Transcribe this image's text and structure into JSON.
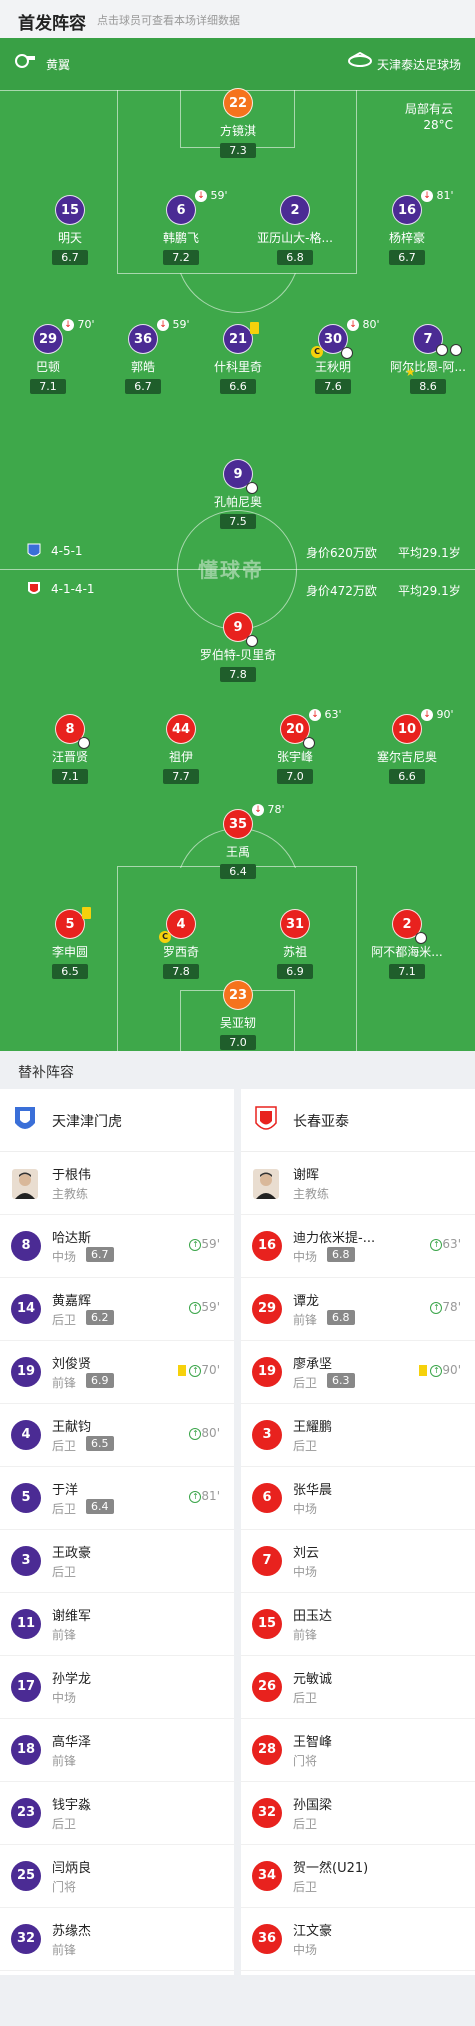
{
  "header": {
    "title": "首发阵容",
    "subtitle": "点击球员可查看本场详细数据"
  },
  "pitch": {
    "weather_icon_label": "whistle-icon",
    "whistle_name": "黄翼",
    "stadium": "天津泰达足球场",
    "weather": "局部有云",
    "temp": "28°C",
    "watermark": "懂球帝",
    "home": {
      "formation": "4-5-1",
      "value": "身价620万欧",
      "avg_age": "平均29.1岁"
    },
    "away": {
      "formation": "4-1-4-1",
      "value": "身价472万欧",
      "avg_age": "平均29.1岁"
    }
  },
  "home_players": [
    {
      "num": "22",
      "name": "方镜淇",
      "rating": "7.3",
      "color": "orange"
    },
    {
      "num": "15",
      "name": "明天",
      "rating": "6.7",
      "color": "purple"
    },
    {
      "num": "6",
      "name": "韩鹏飞",
      "rating": "7.2",
      "color": "purple",
      "sub": "59'"
    },
    {
      "num": "2",
      "name": "亚历山大-格...",
      "rating": "6.8",
      "color": "purple"
    },
    {
      "num": "16",
      "name": "杨梓豪",
      "rating": "6.7",
      "color": "purple",
      "sub": "81'"
    },
    {
      "num": "29",
      "name": "巴顿",
      "rating": "7.1",
      "color": "purple",
      "sub": "70'"
    },
    {
      "num": "36",
      "name": "郭皓",
      "rating": "6.7",
      "color": "purple",
      "sub": "59'"
    },
    {
      "num": "21",
      "name": "什科里奇",
      "rating": "6.6",
      "color": "purple"
    },
    {
      "num": "30",
      "name": "王秋明",
      "rating": "7.6",
      "color": "purple",
      "sub": "80'"
    },
    {
      "num": "7",
      "name": "阿尔比恩-阿...",
      "rating": "8.6",
      "color": "purple"
    },
    {
      "num": "9",
      "name": "孔帕尼奥",
      "rating": "7.5",
      "color": "purple"
    }
  ],
  "away_players": [
    {
      "num": "9",
      "name": "罗伯特-贝里奇",
      "rating": "7.8",
      "color": "red"
    },
    {
      "num": "8",
      "name": "汪晋贤",
      "rating": "7.1",
      "color": "red"
    },
    {
      "num": "44",
      "name": "祖伊",
      "rating": "7.7",
      "color": "red"
    },
    {
      "num": "20",
      "name": "张宇峰",
      "rating": "7.0",
      "color": "red",
      "sub": "63'"
    },
    {
      "num": "10",
      "name": "塞尔吉尼奥",
      "rating": "6.6",
      "color": "red",
      "sub": "90'"
    },
    {
      "num": "35",
      "name": "王禹",
      "rating": "6.4",
      "color": "red",
      "sub": "78'"
    },
    {
      "num": "5",
      "name": "李申圆",
      "rating": "6.5",
      "color": "red"
    },
    {
      "num": "4",
      "name": "罗西奇",
      "rating": "7.8",
      "color": "red"
    },
    {
      "num": "31",
      "name": "苏祖",
      "rating": "6.9",
      "color": "red"
    },
    {
      "num": "2",
      "name": "阿不都海米...",
      "rating": "7.1",
      "color": "red"
    },
    {
      "num": "23",
      "name": "吴亚轫",
      "rating": "7.0",
      "color": "orange"
    }
  ],
  "subs": {
    "title": "替补阵容",
    "home_team": "天津津门虎",
    "away_team": "长春亚泰",
    "home_coach": {
      "name": "于根伟",
      "role": "主教练"
    },
    "away_coach": {
      "name": "谢晖",
      "role": "主教练"
    },
    "home": [
      {
        "num": "8",
        "name": "哈达斯",
        "pos": "中场",
        "rating": "6.7",
        "ev": "59'"
      },
      {
        "num": "14",
        "name": "黄嘉辉",
        "pos": "后卫",
        "rating": "6.2",
        "ev": "59'"
      },
      {
        "num": "19",
        "name": "刘俊贤",
        "pos": "前锋",
        "rating": "6.9",
        "ev": "70'",
        "yc": true
      },
      {
        "num": "4",
        "name": "王献钧",
        "pos": "后卫",
        "rating": "6.5",
        "ev": "80'"
      },
      {
        "num": "5",
        "name": "于洋",
        "pos": "后卫",
        "rating": "6.4",
        "ev": "81'"
      },
      {
        "num": "3",
        "name": "王政豪",
        "pos": "后卫"
      },
      {
        "num": "11",
        "name": "谢维军",
        "pos": "前锋"
      },
      {
        "num": "17",
        "name": "孙学龙",
        "pos": "中场"
      },
      {
        "num": "18",
        "name": "高华泽",
        "pos": "前锋"
      },
      {
        "num": "23",
        "name": "钱宇淼",
        "pos": "后卫"
      },
      {
        "num": "25",
        "name": "闫炳良",
        "pos": "门将"
      },
      {
        "num": "32",
        "name": "苏缘杰",
        "pos": "前锋"
      }
    ],
    "away": [
      {
        "num": "16",
        "name": "迪力依米提-...",
        "pos": "中场",
        "rating": "6.8",
        "ev": "63'"
      },
      {
        "num": "29",
        "name": "谭龙",
        "pos": "前锋",
        "rating": "6.8",
        "ev": "78'"
      },
      {
        "num": "19",
        "name": "廖承坚",
        "pos": "后卫",
        "rating": "6.3",
        "ev": "90'",
        "yc": true
      },
      {
        "num": "3",
        "name": "王耀鹏",
        "pos": "后卫"
      },
      {
        "num": "6",
        "name": "张华晨",
        "pos": "中场"
      },
      {
        "num": "7",
        "name": "刘云",
        "pos": "中场"
      },
      {
        "num": "15",
        "name": "田玉达",
        "pos": "前锋"
      },
      {
        "num": "26",
        "name": "元敏诚",
        "pos": "后卫"
      },
      {
        "num": "28",
        "name": "王智峰",
        "pos": "门将"
      },
      {
        "num": "32",
        "name": "孙国梁",
        "pos": "后卫"
      },
      {
        "num": "34",
        "name": "贺一然(U21)",
        "pos": "后卫"
      },
      {
        "num": "36",
        "name": "江文豪",
        "pos": "中场"
      }
    ]
  },
  "colors": {
    "purple": "#4b2b94",
    "red": "#e8221e",
    "orange": "#f5731d",
    "pitch": "#3ea84a"
  }
}
